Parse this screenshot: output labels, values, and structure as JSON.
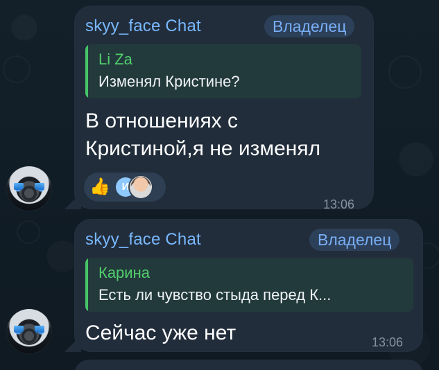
{
  "colors": {
    "background": "#0f1a22",
    "bubble": "#212d3b",
    "sender": "#79b8ff",
    "badge_bg": "#2d4059",
    "badge_text": "#78aef6",
    "reply_bg": "#233a3c",
    "reply_accent": "#46c468",
    "reply_name": "#52ce6d",
    "text": "#ffffff",
    "timestamp": "#8792a0",
    "reaction_bg": "#2e3f53"
  },
  "messages": [
    {
      "sender": "skyy_face Chat",
      "badge": "Владелец",
      "reply": {
        "name": "Li Za",
        "text": "Изменял Кристине?"
      },
      "text_lines": [
        "В отношениях с",
        "Кристиной,я не изменял"
      ],
      "reactions": {
        "emoji_icon": "thumbs-up-icon",
        "initial_avatar": "И",
        "face_avatar_icon": "profile-photo-icon"
      },
      "time": "13:06",
      "avatar_icon": "car-interior-avatar-icon"
    },
    {
      "sender": "skyy_face Chat",
      "badge": "Владелец",
      "reply": {
        "name": "Карина",
        "text": "Есть ли чувство стыда перед К..."
      },
      "text": "Сейчас уже нет",
      "time": "13:06",
      "avatar_icon": "car-interior-avatar-icon"
    }
  ]
}
